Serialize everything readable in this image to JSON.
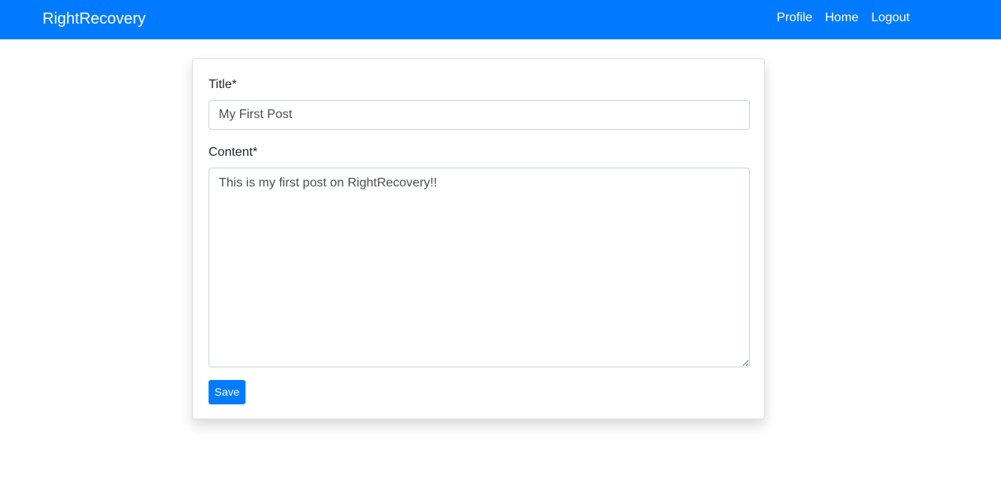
{
  "navbar": {
    "brand": "RightRecovery",
    "links": [
      {
        "label": "Profile"
      },
      {
        "label": "Home"
      },
      {
        "label": "Logout"
      }
    ],
    "background_color": "#007bff"
  },
  "form": {
    "title_label": "Title*",
    "title_value": "My First Post",
    "content_label": "Content*",
    "content_value": "This is my first post on RightRecovery!!",
    "save_label": "Save"
  }
}
